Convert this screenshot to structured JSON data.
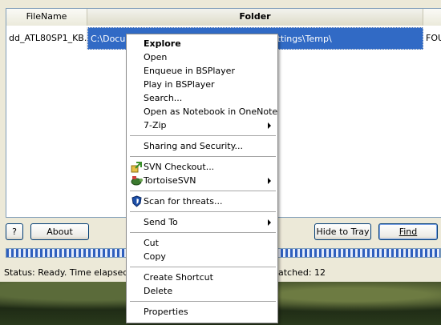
{
  "listview": {
    "columns": [
      "FileName",
      "Folder",
      ""
    ],
    "row": {
      "filename": "dd_ATL80SP1_KB...",
      "folder": "C:\\Documents and Settings\\temp\\Local Settings\\Temp\\",
      "extra": "FOU"
    }
  },
  "buttons": {
    "help": "?",
    "about": "About",
    "hide_to_tray": "Hide to Tray",
    "find": "Find"
  },
  "status": {
    "left": "Status: Ready.  Time elapsed",
    "right": "atched: 12"
  },
  "context_menu": {
    "groups": [
      [
        {
          "label": "Explore",
          "bold": true
        },
        {
          "label": "Open"
        },
        {
          "label": "Enqueue in BSPlayer"
        },
        {
          "label": "Play in BSPlayer"
        },
        {
          "label": "Search..."
        },
        {
          "label": "Open as Notebook in OneNote"
        },
        {
          "label": "7-Zip",
          "submenu": true
        }
      ],
      [
        {
          "label": "Sharing and Security..."
        }
      ],
      [
        {
          "label": "SVN Checkout...",
          "icon": "svn-checkout-icon"
        },
        {
          "label": "TortoiseSVN",
          "icon": "tortoisesvn-icon",
          "submenu": true
        }
      ],
      [
        {
          "label": "Scan for threats...",
          "icon": "shield-icon"
        }
      ],
      [
        {
          "label": "Send To",
          "submenu": true
        }
      ],
      [
        {
          "label": "Cut"
        },
        {
          "label": "Copy"
        }
      ],
      [
        {
          "label": "Create Shortcut"
        },
        {
          "label": "Delete"
        }
      ],
      [
        {
          "label": "Properties"
        }
      ]
    ]
  },
  "colors": {
    "selection": "#316ac5",
    "window_bg": "#ece9d8",
    "progress": "#2f5fbd"
  }
}
